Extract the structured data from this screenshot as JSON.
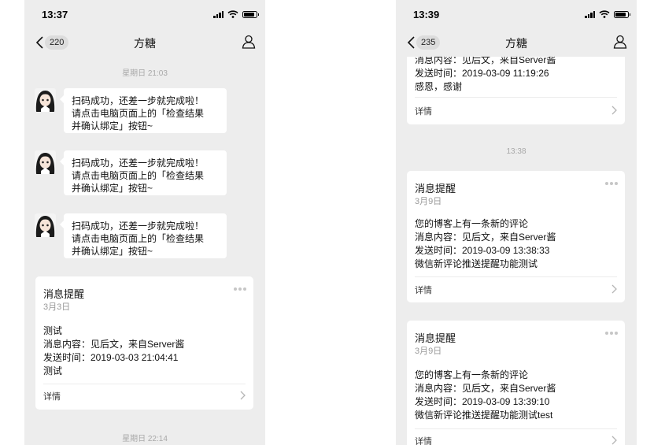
{
  "left": {
    "status_time": "13:37",
    "nav": {
      "count": "220",
      "title": "方糖"
    },
    "time_separator_1": "星期日 21:03",
    "bot_messages": [
      {
        "lines": [
          "扫码成功，还差一步就完成啦！",
          "请点击电脑页面上的「检查结果",
          "并确认绑定」按钮~"
        ]
      },
      {
        "lines": [
          "扫码成功，还差一步就完成啦！",
          "请点击电脑页面上的「检查结果",
          "并确认绑定」按钮~"
        ]
      },
      {
        "lines": [
          "扫码成功，还差一步就完成啦！",
          "请点击电脑页面上的「检查结果",
          "并确认绑定」按钮~"
        ]
      }
    ],
    "card": {
      "title": "消息提醒",
      "date": "3月3日",
      "body": [
        "测试",
        "消息内容：见后文，来自Server酱",
        "发送时间：2019-03-03 21:04:41",
        "测试"
      ],
      "detail": "详情"
    },
    "time_separator_2": "星期日 22:14"
  },
  "right": {
    "status_time": "13:39",
    "nav": {
      "count": "235",
      "title": "方糖"
    },
    "top_card": {
      "body": [
        "消息内容：见后文，来自Server酱",
        "发送时间：2019-03-09 11:19:26",
        "感恩，感谢"
      ],
      "detail": "详情"
    },
    "time_separator": "13:38",
    "cards": [
      {
        "title": "消息提醒",
        "date": "3月9日",
        "body": [
          "您的博客上有一条新的评论",
          "消息内容：见后文，来自Server酱",
          "发送时间：2019-03-09 13:38:33",
          "微信新评论推送提醒功能测试"
        ],
        "detail": "详情"
      },
      {
        "title": "消息提醒",
        "date": "3月9日",
        "body": [
          "您的博客上有一条新的评论",
          "消息内容：见后文，来自Server酱",
          "发送时间：2019-03-09 13:39:10",
          "微信新评论推送提醒功能测试test"
        ],
        "detail": "详情"
      }
    ]
  },
  "icons": {
    "back": "chevron-left-icon",
    "profile": "person-icon",
    "more": "more-dots-icon",
    "detail": "chevron-right-icon"
  },
  "colors": {
    "chat_background": "#ededed",
    "bubble": "#ffffff",
    "timestamp": "#a8a8a8"
  }
}
